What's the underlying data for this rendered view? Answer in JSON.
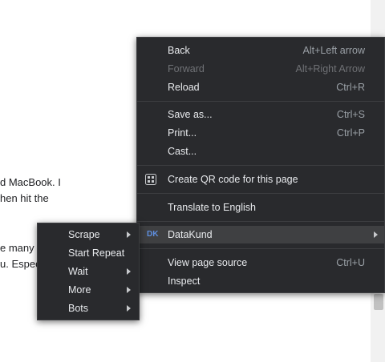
{
  "page": {
    "line1": "d MacBook. I",
    "line2": "hen hit the",
    "line3": "e many",
    "line4": "u. Especi"
  },
  "context_menu": {
    "back": {
      "label": "Back",
      "shortcut": "Alt+Left arrow"
    },
    "forward": {
      "label": "Forward",
      "shortcut": "Alt+Right Arrow"
    },
    "reload": {
      "label": "Reload",
      "shortcut": "Ctrl+R"
    },
    "save_as": {
      "label": "Save as...",
      "shortcut": "Ctrl+S"
    },
    "print": {
      "label": "Print...",
      "shortcut": "Ctrl+P"
    },
    "cast": {
      "label": "Cast..."
    },
    "qr_code": {
      "label": "Create QR code for this page",
      "icon": "qr-code-icon"
    },
    "translate": {
      "label": "Translate to English"
    },
    "datakund": {
      "label": "DataKund",
      "icon": "datakund-icon"
    },
    "view_source": {
      "label": "View page source",
      "shortcut": "Ctrl+U"
    },
    "inspect": {
      "label": "Inspect"
    }
  },
  "submenu": {
    "items": [
      {
        "label": "Scrape",
        "has_submenu": true
      },
      {
        "label": "Start Repeat",
        "has_submenu": false
      },
      {
        "label": "Wait",
        "has_submenu": true
      },
      {
        "label": "More",
        "has_submenu": true
      },
      {
        "label": "Bots",
        "has_submenu": true
      }
    ]
  },
  "colors": {
    "menu_bg": "#292a2d",
    "menu_text": "#e8eaed",
    "shortcut_text": "#9aa0a6",
    "hover_bg": "#3f4042"
  }
}
